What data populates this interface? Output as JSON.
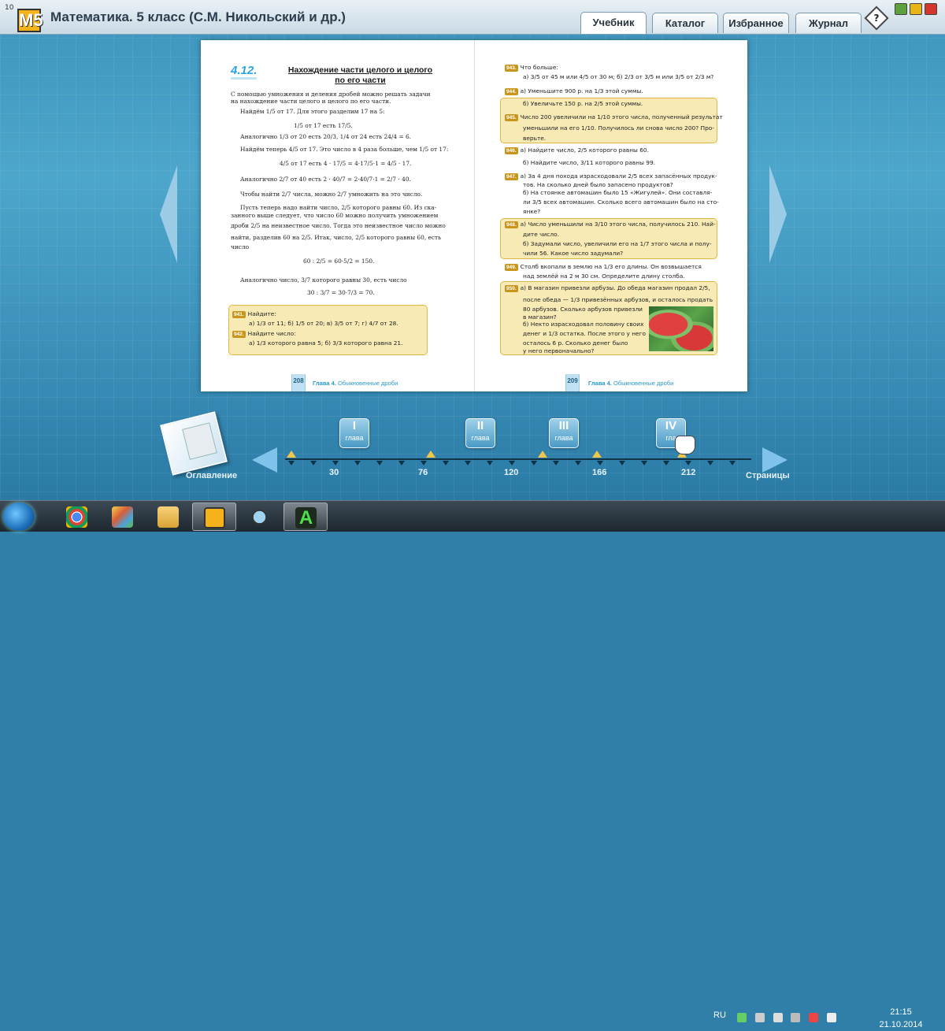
{
  "window": {
    "logo_number": "10",
    "logo_text": "M5",
    "title": "Математика. 5 класс (С.М. Никольский и др.)",
    "tabs": [
      "Учебник",
      "Каталог",
      "Избранное",
      "Журнал"
    ],
    "help_label": "?"
  },
  "book": {
    "left": {
      "section_number": "4.12.",
      "section_title_1": "Нахождение части целого и целого",
      "section_title_2": "по его части",
      "lines": [
        "С помощью умножения и деления дробей можно решать задачи",
        "на нахождение части целого и целого по его части.",
        "Найдём 1/5 от 17. Для этого разделим 17 на 5:",
        "1/5 от 17 есть 17/5.",
        "Аналогично 1/3 от 20 есть 20/3, 1/4 от 24 есть 24/4 = 6.",
        "Найдём теперь 4/5 от 17. Это число в 4 раза больше, чем 1/5 от 17:",
        "4/5 от 17 есть 4 · 17/5 = 4·17/5·1 = 4/5 · 17.",
        "Аналогично 2/7 от 40 есть 2 · 40/7 = 2·40/7·1 = 2/7 · 40.",
        "Чтобы найти 2/7 числа, можно 2/7 умножить на это число.",
        "Пусть теперь надо найти число, 2/5 которого равны 60. Из ска-",
        "занного выше следует, что число 60 можно получить умножением",
        "дроби 2/5 на неизвестное число. Тогда это неизвестное число можно",
        "найти, разделив 60 на 2/5. Итак, число, 2/5 которого равны 60, есть",
        "число",
        "60 : 2/5 = 60·5/2 = 150.",
        "Аналогично число, 3/7 которого равны 30, есть число",
        "30 : 3/7 = 30·7/3 = 70."
      ],
      "exercises": [
        {
          "num": "941.",
          "text": "Найдите:"
        },
        {
          "num": "",
          "text": "а) 1/3 от 11;     б) 1/5 от 20;     в) 3/5 от 7;     г) 4/7 от 28."
        },
        {
          "num": "942.",
          "text": "Найдите число:"
        },
        {
          "num": "",
          "text": "а) 1/3 которого равна 5;     б) 3/3 которого равна 21."
        }
      ],
      "page_number": "208",
      "chapter": "Глава 4.",
      "chapter_name": "Обыкновенные дроби"
    },
    "right": {
      "lines": [
        {
          "num": "943.",
          "text": "Что больше:",
          "hl": false
        },
        {
          "num": "",
          "text": "а) 3/5 от 45 м или 4/5 от 30 м;     б) 2/3 от 3/5 м или 3/5 от 2/3 м?",
          "hl": false
        },
        {
          "num": "944.",
          "text": "а) Уменьшите 900 р. на 1/3 этой суммы.",
          "hl": false
        },
        {
          "num": "",
          "text": "б) Увеличьте 150 р. на 2/5 этой суммы.",
          "hl": true
        },
        {
          "num": "945.",
          "text": "Число 200 увеличили на 1/10 этого числа, полученный результат",
          "hl": true
        },
        {
          "num": "",
          "text": "уменьшили на его 1/10. Получилось ли снова число 200? Про-",
          "hl": true
        },
        {
          "num": "",
          "text": "верьте.",
          "hl": true
        },
        {
          "num": "946.",
          "text": "а) Найдите число, 2/5 которого равны 60.",
          "hl": false
        },
        {
          "num": "",
          "text": "б) Найдите число, 3/11 которого равны 99.",
          "hl": false
        },
        {
          "num": "947.",
          "text": "а) За 4 дня похода израсходовали 2/5 всех запасённых продук-",
          "hl": false
        },
        {
          "num": "",
          "text": "тов. На сколько дней было запасено продуктов?",
          "hl": false
        },
        {
          "num": "",
          "text": "б) На стоянке автомашин было 15 «Жигулей». Они составля-",
          "hl": false
        },
        {
          "num": "",
          "text": "ли 3/5 всех автомашин. Сколько всего автомашин было на сто-",
          "hl": false
        },
        {
          "num": "",
          "text": "янке?",
          "hl": false
        },
        {
          "num": "948.",
          "text": "а) Число уменьшили на 3/10 этого числа, получилось 210. Най-",
          "hl": true
        },
        {
          "num": "",
          "text": "дите число.",
          "hl": true
        },
        {
          "num": "",
          "text": "б) Задумали число, увеличили его на 1/7 этого числа и полу-",
          "hl": true
        },
        {
          "num": "",
          "text": "чили 56. Какое число задумали?",
          "hl": true
        },
        {
          "num": "949.",
          "text": "Столб вкопали в землю на 1/3 его длины. Он возвышается",
          "hl": false
        },
        {
          "num": "",
          "text": "над землёй на 2 м 30 см. Определите длину столба.",
          "hl": false
        },
        {
          "num": "950.",
          "text": "а) В магазин привезли арбузы. До обеда магазин продал 2/5,",
          "hl": true
        },
        {
          "num": "",
          "text": "после обеда — 1/3 привезённых арбузов, и осталось продать",
          "hl": true
        },
        {
          "num": "",
          "text": "80 арбузов. Сколько арбузов привезли",
          "hl": true
        },
        {
          "num": "",
          "text": "в магазин?",
          "hl": true
        },
        {
          "num": "",
          "text": "б) Некто израсходовал половину своих",
          "hl": true
        },
        {
          "num": "",
          "text": "денег и 1/3 остатка. После этого у него",
          "hl": true
        },
        {
          "num": "",
          "text": "осталось 6 р. Сколько денег было",
          "hl": true
        },
        {
          "num": "",
          "text": "у него первоначально?",
          "hl": true
        }
      ],
      "page_number": "209",
      "chapter": "Глава 4.",
      "chapter_name": "Обыкновенные дроби"
    }
  },
  "navigation": {
    "toc_label": "Оглавление",
    "pages_label": "Страницы",
    "chapters": [
      {
        "roman": "I",
        "label": "глава"
      },
      {
        "roman": "II",
        "label": "глава"
      },
      {
        "roman": "III",
        "label": "глава"
      },
      {
        "roman": "IV",
        "label": "гла"
      }
    ],
    "page_marks": [
      "30",
      "76",
      "120",
      "166",
      "212"
    ]
  },
  "taskbar": {
    "language": "RU",
    "time": "21:15",
    "date": "21.10.2014"
  }
}
